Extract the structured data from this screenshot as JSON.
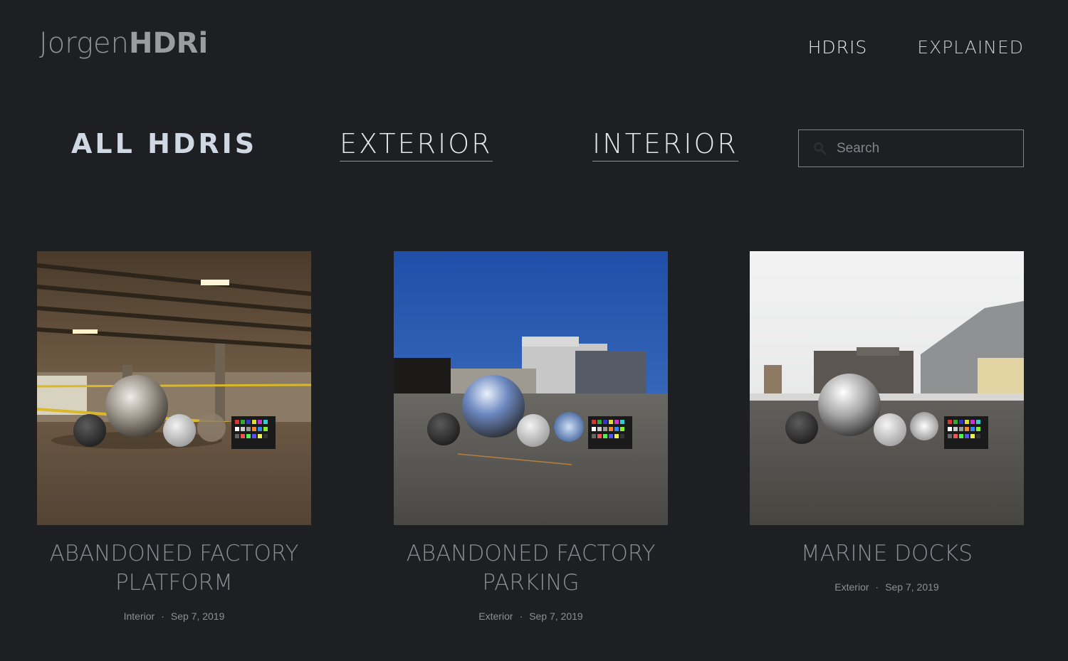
{
  "header": {
    "logo_light": "Jorgen",
    "logo_bold": "HDRi",
    "nav": [
      "HDRIS",
      "EXPLAINED"
    ]
  },
  "filters": {
    "all": "ALL HDRIS",
    "exterior": "EXTERIOR",
    "interior": "INTERIOR",
    "active": "all"
  },
  "search": {
    "placeholder": "Search",
    "icon": "search-icon"
  },
  "cards": [
    {
      "title_line1": "ABANDONED FACTORY",
      "title_line2": "PLATFORM",
      "category": "Interior",
      "date": "Sep 7, 2019"
    },
    {
      "title_line1": "ABANDONED FACTORY",
      "title_line2": "PARKING",
      "category": "Exterior",
      "date": "Sep 7, 2019"
    },
    {
      "title_line1": "MARINE DOCKS",
      "title_line2": "",
      "category": "Exterior",
      "date": "Sep 7, 2019"
    }
  ],
  "colors": {
    "background": "#1d1f22",
    "active_filter": "#d0d9e3",
    "sky_blue": "#2f5fae"
  }
}
